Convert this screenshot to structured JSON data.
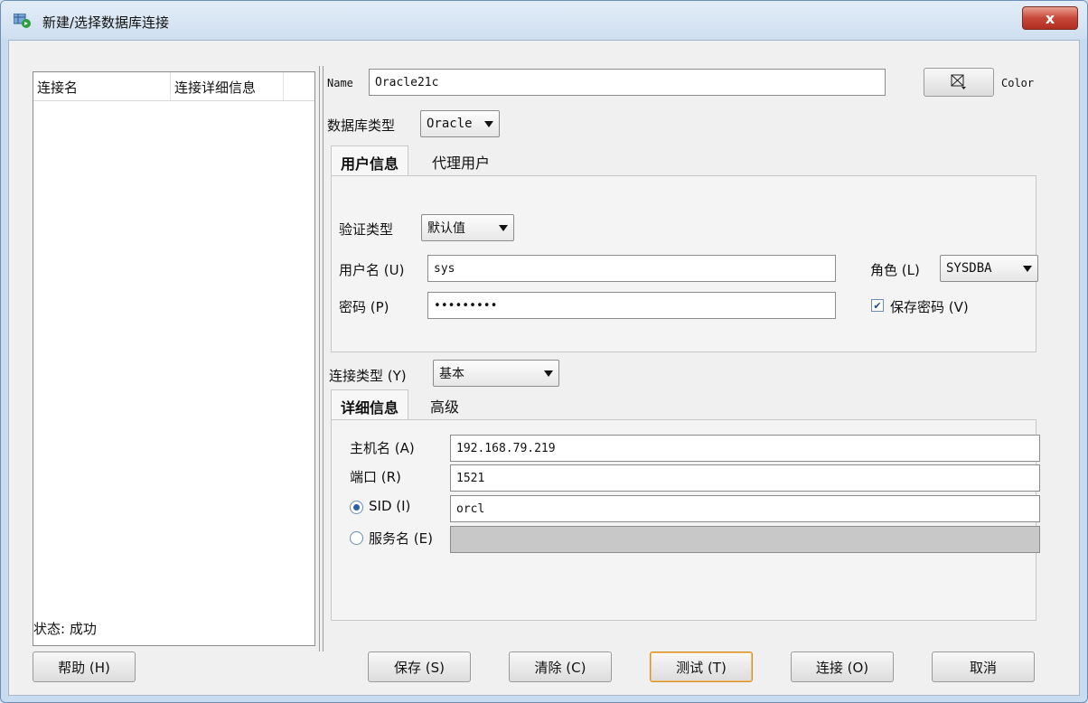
{
  "window": {
    "title": "新建/选择数据库连接",
    "close_glyph": "x"
  },
  "connection_list": {
    "columns": [
      "连接名",
      "连接详细信息"
    ],
    "rows": []
  },
  "status": "状态: 成功",
  "form": {
    "name_label": "Name",
    "name_value": "Oracle21c",
    "color_label": "Color",
    "db_type_label": "数据库类型",
    "db_type_value": "Oracle",
    "user_tabs": [
      "用户信息",
      "代理用户"
    ],
    "auth_type_label": "验证类型",
    "auth_type_value": "默认值",
    "username_label": "用户名 (U)",
    "username_value": "sys",
    "role_label": "角色 (L)",
    "role_value": "SYSDBA",
    "password_label": "密码 (P)",
    "password_value": "•••••••••",
    "save_password_label": "保存密码 (V)",
    "save_password_checked": true,
    "conn_type_label": "连接类型 (Y)",
    "conn_type_value": "基本",
    "detail_tabs": [
      "详细信息",
      "高级"
    ],
    "hostname_label": "主机名 (A)",
    "hostname_value": "192.168.79.219",
    "port_label": "端口 (R)",
    "port_value": "1521",
    "sid_label": "SID (I)",
    "sid_value": "orcl",
    "service_label": "服务名 (E)",
    "service_value": ""
  },
  "buttons": {
    "help": "帮助 (H)",
    "save": "保存 (S)",
    "clear": "清除 (C)",
    "test": "测试 (T)",
    "connect": "连接 (O)",
    "cancel": "取消"
  },
  "colors": {
    "accent": "#2b5fa8",
    "close": "#c7473a",
    "focus": "#d98c2c"
  }
}
